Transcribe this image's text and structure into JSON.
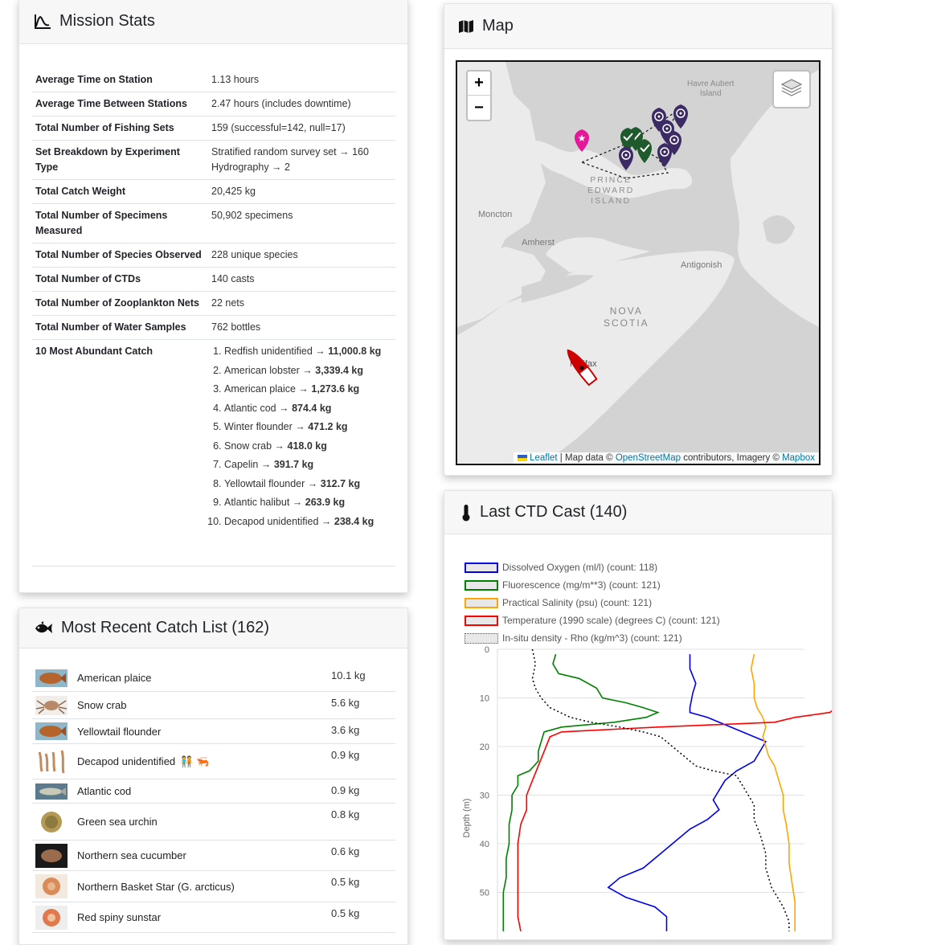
{
  "stats": {
    "title": "Mission Stats",
    "rows": [
      {
        "label": "Average Time on Station",
        "value": "1.13 hours"
      },
      {
        "label": "Average Time Between Stations",
        "value": "2.47 hours (includes downtime)"
      },
      {
        "label": "Total Number of Fishing Sets",
        "value": "159 (successful=142, null=17)"
      },
      {
        "label": "Set Breakdown by Experiment Type",
        "value": "Stratified random survey set → 160",
        "value2": "Hydrography → 2"
      },
      {
        "label": "Total Catch Weight",
        "value": "20,425 kg"
      },
      {
        "label": "Total Number of Specimens Measured",
        "value": "50,902 specimens"
      },
      {
        "label": "Total Number of Species Observed",
        "value": "228 unique species"
      },
      {
        "label": "Total Number of CTDs",
        "value": "140 casts"
      },
      {
        "label": "Total Number of Zooplankton Nets",
        "value": "22 nets"
      },
      {
        "label": "Total Number of Water Samples",
        "value": "762 bottles"
      }
    ],
    "abundant_label": "10 Most Abundant Catch",
    "abundant": [
      {
        "name": "Redfish unidentified",
        "weight": "11,000.8 kg"
      },
      {
        "name": "American lobster",
        "weight": "3,339.4 kg"
      },
      {
        "name": "American plaice",
        "weight": "1,273.6 kg"
      },
      {
        "name": "Atlantic cod",
        "weight": "874.4 kg"
      },
      {
        "name": "Winter flounder",
        "weight": "471.2 kg"
      },
      {
        "name": "Snow crab",
        "weight": "418.0 kg"
      },
      {
        "name": "Capelin",
        "weight": "391.7 kg"
      },
      {
        "name": "Yellowtail flounder",
        "weight": "312.7 kg"
      },
      {
        "name": "Atlantic halibut",
        "weight": "263.9 kg"
      },
      {
        "name": "Decapod unidentified",
        "weight": "238.4 kg"
      }
    ],
    "arrow": " → "
  },
  "catch": {
    "title": "Most Recent Catch List (162)",
    "items": [
      {
        "name": "American plaice",
        "weight": "10.1 kg",
        "icon": "flatfish-photo"
      },
      {
        "name": "Snow crab",
        "weight": "5.6 kg",
        "icon": "crab-photo"
      },
      {
        "name": "Yellowtail flounder",
        "weight": "3.6 kg",
        "icon": "flatfish-photo"
      },
      {
        "name": "Decapod unidentified",
        "weight": "0.9 kg",
        "icon": "shrimp-photo",
        "badges": "🧑‍🤝‍🧑 🦐"
      },
      {
        "name": "Atlantic cod",
        "weight": "0.9 kg",
        "icon": "cod-photo"
      },
      {
        "name": "Green sea urchin",
        "weight": "0.8 kg",
        "icon": "urchin-photo"
      },
      {
        "name": "Northern sea cucumber",
        "weight": "0.6 kg",
        "icon": "cucumber-photo"
      },
      {
        "name": "Northern Basket Star (G. arcticus)",
        "weight": "0.5 kg",
        "icon": "basketstar-photo"
      },
      {
        "name": "Red spiny sunstar",
        "weight": "0.5 kg",
        "icon": "sunstar-photo"
      }
    ]
  },
  "map": {
    "title": "Map",
    "zoom_in": "+",
    "zoom_out": "−",
    "labels": {
      "havre": "Havre Aubert",
      "island": "Island",
      "pei1": "PRINCE",
      "pei2": "EDWARD",
      "pei3": "ISLAND",
      "moncton": "Moncton",
      "amherst": "Amherst",
      "antigonish": "Antigonish",
      "ns1": "NOVA",
      "ns2": "SCOTIA",
      "halifax": "Halifax"
    },
    "attribution": {
      "leaflet": "Leaflet",
      "mapdata": " | Map data © ",
      "osm": "OpenStreetMap",
      "contrib": " contributors, Imagery © ",
      "mapbox": "Mapbox"
    },
    "colors": {
      "water": "#d4d4d4",
      "land": "#ececec",
      "station": "#3b2a63",
      "set": "#1f5a2c",
      "start": "#e4179a",
      "ship": "#cc0000"
    }
  },
  "ctd": {
    "title": "Last CTD Cast (140)",
    "ylabel": "Depth (m)",
    "legend": [
      {
        "label": "Dissolved Oxygen (ml/l) (count: 118)",
        "color": "#0000ee",
        "style": "solid"
      },
      {
        "label": "Fluorescence (mg/m**3) (count: 121)",
        "color": "#008000",
        "style": "solid"
      },
      {
        "label": "Practical Salinity (psu) (count: 121)",
        "color": "#ffa500",
        "style": "solid"
      },
      {
        "label": "Temperature (1990 scale) (degrees C) (count: 121)",
        "color": "#ff0000",
        "style": "solid"
      },
      {
        "label": "In-situ density - Rho (kg/m^3) (count: 121)",
        "color": "#000000",
        "style": "dotted"
      }
    ]
  },
  "chart_data": {
    "type": "line",
    "ylabel": "Depth (m)",
    "ylim": [
      0,
      58
    ],
    "y_ticks": [
      0,
      10,
      20,
      30,
      40,
      50
    ],
    "y_inverted": true,
    "series": [
      {
        "name": "Dissolved Oxygen (ml/l) (count: 118)",
        "color": "#0000ee",
        "points": [
          [
            0.66,
            1
          ],
          [
            0.66,
            4
          ],
          [
            0.68,
            7
          ],
          [
            0.67,
            9
          ],
          [
            0.66,
            12
          ],
          [
            0.66,
            13
          ],
          [
            0.72,
            14
          ],
          [
            0.8,
            16
          ],
          [
            0.88,
            18
          ],
          [
            0.92,
            19
          ],
          [
            0.9,
            21
          ],
          [
            0.88,
            23
          ],
          [
            0.82,
            25
          ],
          [
            0.78,
            27
          ],
          [
            0.76,
            29
          ],
          [
            0.74,
            31
          ],
          [
            0.76,
            33
          ],
          [
            0.72,
            35
          ],
          [
            0.66,
            37
          ],
          [
            0.62,
            39
          ],
          [
            0.56,
            42
          ],
          [
            0.5,
            45
          ],
          [
            0.42,
            47
          ],
          [
            0.38,
            49
          ],
          [
            0.44,
            51
          ],
          [
            0.54,
            53
          ],
          [
            0.58,
            55
          ],
          [
            0.58,
            58
          ]
        ]
      },
      {
        "name": "Fluorescence (mg/m**3) (count: 121)",
        "color": "#008000",
        "points": [
          [
            0.2,
            1
          ],
          [
            0.19,
            3
          ],
          [
            0.21,
            5
          ],
          [
            0.28,
            6
          ],
          [
            0.34,
            8
          ],
          [
            0.36,
            10
          ],
          [
            0.44,
            11
          ],
          [
            0.5,
            12
          ],
          [
            0.55,
            13
          ],
          [
            0.51,
            14
          ],
          [
            0.4,
            15
          ],
          [
            0.22,
            16
          ],
          [
            0.16,
            17
          ],
          [
            0.15,
            19
          ],
          [
            0.14,
            21
          ],
          [
            0.14,
            23
          ],
          [
            0.11,
            25
          ],
          [
            0.07,
            26
          ],
          [
            0.07,
            28
          ],
          [
            0.05,
            30
          ],
          [
            0.05,
            33
          ],
          [
            0.04,
            36
          ],
          [
            0.04,
            40
          ],
          [
            0.03,
            43
          ],
          [
            0.03,
            47
          ],
          [
            0.02,
            50
          ],
          [
            0.02,
            54
          ],
          [
            0.02,
            58
          ]
        ]
      },
      {
        "name": "Practical Salinity (psu) (count: 121)",
        "color": "#ffa500",
        "points": [
          [
            0.88,
            1
          ],
          [
            0.87,
            4
          ],
          [
            0.88,
            7
          ],
          [
            0.88,
            10
          ],
          [
            0.89,
            12
          ],
          [
            0.91,
            14
          ],
          [
            0.92,
            16
          ],
          [
            0.91,
            18
          ],
          [
            0.92,
            20
          ],
          [
            0.93,
            22
          ],
          [
            0.95,
            24
          ],
          [
            0.96,
            26
          ],
          [
            0.97,
            28
          ],
          [
            0.98,
            30
          ],
          [
            0.98,
            33
          ],
          [
            0.99,
            36
          ],
          [
            1.0,
            40
          ],
          [
            1.0,
            44
          ],
          [
            1.01,
            48
          ],
          [
            1.02,
            52
          ],
          [
            1.02,
            55
          ],
          [
            1.02,
            58
          ]
        ]
      },
      {
        "name": "Temperature (1990 scale) (degrees C) (count: 121)",
        "color": "#ff0000",
        "points": [
          [
            1.22,
            0
          ],
          [
            1.22,
            3
          ],
          [
            1.22,
            6
          ],
          [
            1.21,
            8
          ],
          [
            1.18,
            10
          ],
          [
            1.16,
            12
          ],
          [
            1.14,
            13
          ],
          [
            1.02,
            14
          ],
          [
            0.95,
            15
          ],
          [
            0.55,
            16
          ],
          [
            0.22,
            17
          ],
          [
            0.18,
            18
          ],
          [
            0.16,
            21
          ],
          [
            0.14,
            24
          ],
          [
            0.12,
            27
          ],
          [
            0.1,
            30
          ],
          [
            0.1,
            33
          ],
          [
            0.08,
            36
          ],
          [
            0.07,
            40
          ],
          [
            0.07,
            44
          ],
          [
            0.07,
            48
          ],
          [
            0.07,
            52
          ],
          [
            0.07,
            55
          ],
          [
            0.08,
            58
          ]
        ]
      },
      {
        "name": "In-situ density - Rho (kg/m^3) (count: 121)",
        "color": "#000000",
        "points": [
          [
            0.12,
            0
          ],
          [
            0.13,
            3
          ],
          [
            0.12,
            6
          ],
          [
            0.13,
            8
          ],
          [
            0.15,
            10
          ],
          [
            0.18,
            12
          ],
          [
            0.25,
            14
          ],
          [
            0.32,
            15
          ],
          [
            0.42,
            16
          ],
          [
            0.5,
            17
          ],
          [
            0.56,
            18
          ],
          [
            0.6,
            20
          ],
          [
            0.64,
            22
          ],
          [
            0.68,
            24
          ],
          [
            0.74,
            25
          ],
          [
            0.82,
            26
          ],
          [
            0.84,
            28
          ],
          [
            0.86,
            30
          ],
          [
            0.88,
            32
          ],
          [
            0.88,
            35
          ],
          [
            0.9,
            38
          ],
          [
            0.92,
            42
          ],
          [
            0.92,
            45
          ],
          [
            0.94,
            49
          ],
          [
            0.98,
            53
          ],
          [
            1.0,
            56
          ],
          [
            1.0,
            58
          ]
        ]
      }
    ]
  }
}
